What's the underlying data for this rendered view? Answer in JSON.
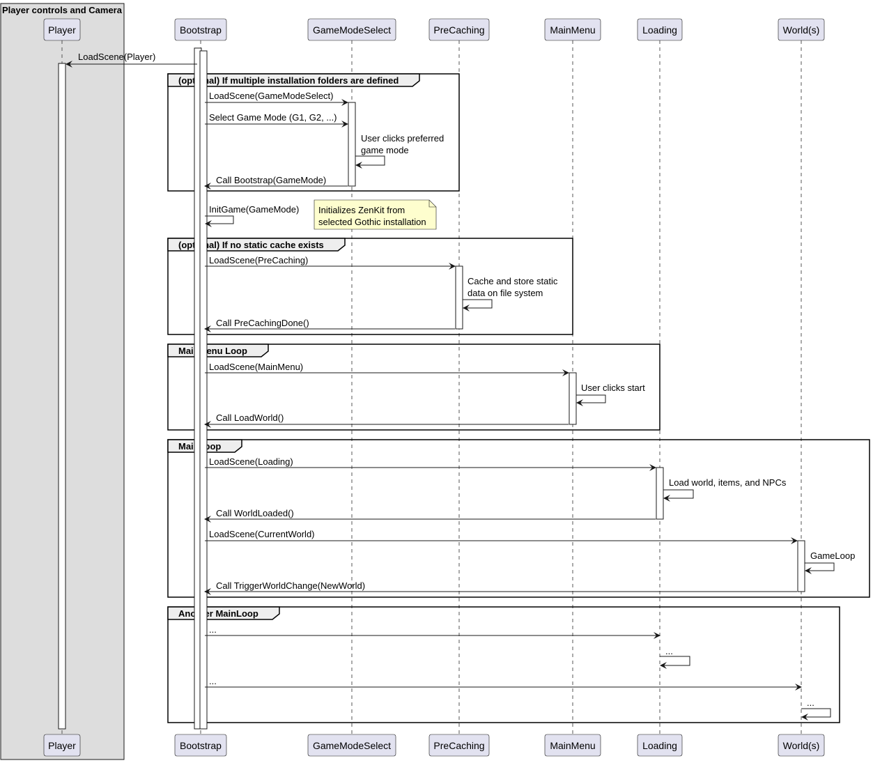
{
  "box": {
    "title": "Player controls and Camera"
  },
  "participants": [
    {
      "id": "player",
      "label": "Player"
    },
    {
      "id": "bootstrap",
      "label": "Bootstrap"
    },
    {
      "id": "gamemodeselect",
      "label": "GameModeSelect"
    },
    {
      "id": "precaching",
      "label": "PreCaching"
    },
    {
      "id": "mainmenu",
      "label": "MainMenu"
    },
    {
      "id": "loading",
      "label": "Loading"
    },
    {
      "id": "worlds",
      "label": "World(s)"
    }
  ],
  "frames": [
    {
      "id": "frame-installation",
      "label": "(optional) If multiple installation folders are defined"
    },
    {
      "id": "frame-cache",
      "label": "(optional) If no static cache exists"
    },
    {
      "id": "frame-mainmenu",
      "label": "MainMenu Loop"
    },
    {
      "id": "frame-mainloop",
      "label": "MainLoop"
    },
    {
      "id": "frame-another",
      "label": "Another MainLoop"
    }
  ],
  "note": {
    "lines": [
      "Initializes ZenKit from",
      "selected Gothic installation"
    ]
  },
  "messages": [
    {
      "id": "m1",
      "lines": [
        "LoadScene(Player)"
      ]
    },
    {
      "id": "m2",
      "lines": [
        "LoadScene(GameModeSelect)"
      ]
    },
    {
      "id": "m3",
      "lines": [
        "Select Game Mode (G1, G2, ...)"
      ]
    },
    {
      "id": "m4",
      "lines": [
        "User clicks preferred",
        "game mode"
      ]
    },
    {
      "id": "m5",
      "lines": [
        "Call Bootstrap(GameMode)"
      ]
    },
    {
      "id": "m6",
      "lines": [
        "InitGame(GameMode)"
      ]
    },
    {
      "id": "m7",
      "lines": [
        "LoadScene(PreCaching)"
      ]
    },
    {
      "id": "m8",
      "lines": [
        "Cache and store static",
        "data on file system"
      ]
    },
    {
      "id": "m9",
      "lines": [
        "Call PreCachingDone()"
      ]
    },
    {
      "id": "m10",
      "lines": [
        "LoadScene(MainMenu)"
      ]
    },
    {
      "id": "m11",
      "lines": [
        "User clicks start"
      ]
    },
    {
      "id": "m12",
      "lines": [
        "Call LoadWorld()"
      ]
    },
    {
      "id": "m13",
      "lines": [
        "LoadScene(Loading)"
      ]
    },
    {
      "id": "m14",
      "lines": [
        "Load world, items, and NPCs"
      ]
    },
    {
      "id": "m15",
      "lines": [
        "Call WorldLoaded()"
      ]
    },
    {
      "id": "m16",
      "lines": [
        "LoadScene(CurrentWorld)"
      ]
    },
    {
      "id": "m17",
      "lines": [
        "GameLoop"
      ]
    },
    {
      "id": "m18",
      "lines": [
        "Call TriggerWorldChange(NewWorld)"
      ]
    },
    {
      "id": "m19",
      "lines": [
        "..."
      ]
    },
    {
      "id": "m20",
      "lines": [
        "..."
      ]
    },
    {
      "id": "m21",
      "lines": [
        "..."
      ]
    },
    {
      "id": "m22",
      "lines": [
        "..."
      ]
    }
  ],
  "colors": {
    "participant_fill": "#e2e2f0",
    "participant_stroke": "#181818",
    "box_fill": "#dddddd",
    "note_fill": "#fefece",
    "line": "#181818",
    "lifeline": "#555555"
  }
}
